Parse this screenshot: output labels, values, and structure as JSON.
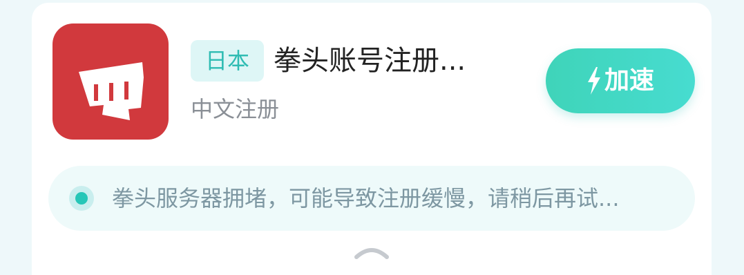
{
  "app": {
    "icon": "riot-fist-icon",
    "icon_color": "#d1393d"
  },
  "region_badge": "日本",
  "title": "拳头账号注册...",
  "subtitle": "中文注册",
  "accelerate_button": {
    "icon": "lightning-bolt-icon",
    "label": "加速",
    "color": "#3fd4b9"
  },
  "notice": {
    "icon": "status-dot-icon",
    "text": "拳头服务器拥堵，可能导致注册缓慢，请稍后再试..."
  },
  "collapse_icon": "chevron-up-icon"
}
